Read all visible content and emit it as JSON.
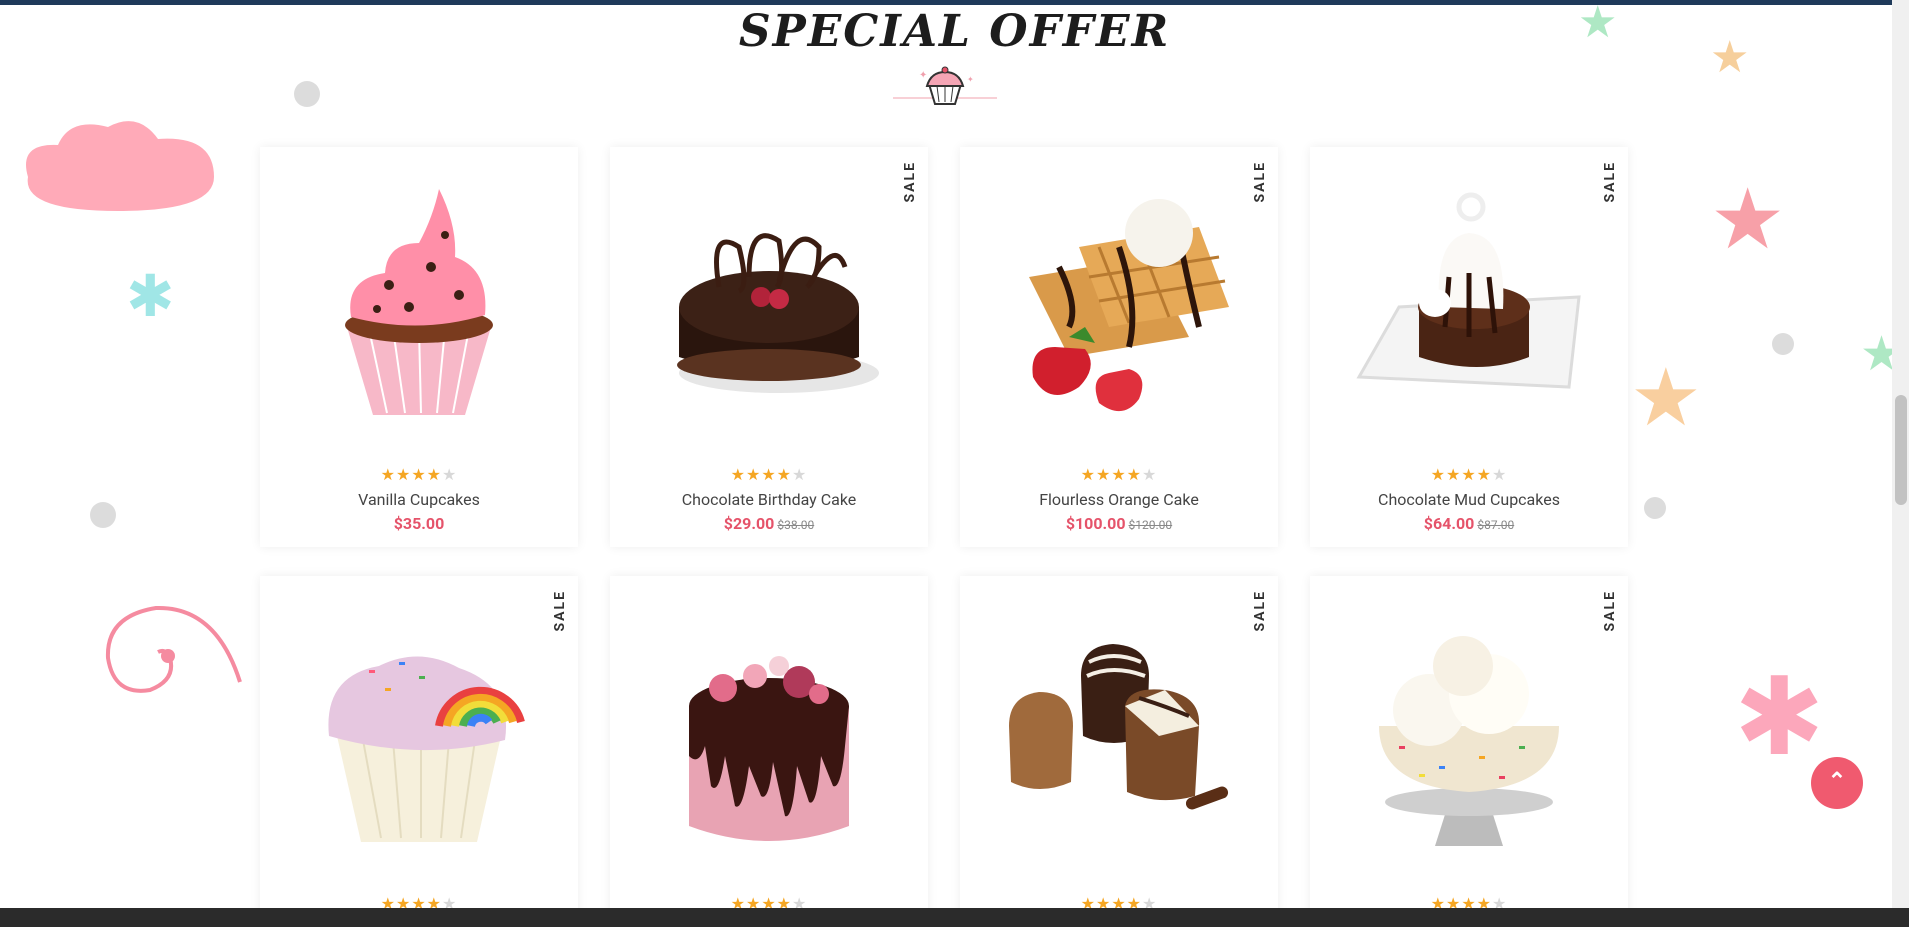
{
  "section": {
    "title": "SPECIAL OFFER"
  },
  "colors": {
    "accent": "#e5536a",
    "star": "#f5a623",
    "star_empty": "#d8d8d8",
    "back_to_top": "#f05a6f"
  },
  "products": [
    {
      "name": "Vanilla Cupcakes",
      "price": "$35.00",
      "old_price": "",
      "sale": "",
      "rating": 4,
      "image": "pink-frosted-cupcake"
    },
    {
      "name": "Chocolate Birthday Cake",
      "price": "$29.00",
      "old_price": "$38.00",
      "sale": "SALE",
      "rating": 4,
      "image": "chocolate-cake"
    },
    {
      "name": "Flourless Orange Cake",
      "price": "$100.00",
      "old_price": "$120.00",
      "sale": "SALE",
      "rating": 4,
      "image": "waffles-strawberries"
    },
    {
      "name": "Chocolate Mud Cupcakes",
      "price": "$64.00",
      "old_price": "$87.00",
      "sale": "SALE",
      "rating": 4,
      "image": "chocolate-mud-cake-plate"
    },
    {
      "name": "",
      "price": "",
      "old_price": "",
      "sale": "SALE",
      "rating": 4,
      "image": "rainbow-cupcake"
    },
    {
      "name": "",
      "price": "",
      "old_price": "",
      "sale": "",
      "rating": 4,
      "image": "pink-drip-cake"
    },
    {
      "name": "",
      "price": "",
      "old_price": "",
      "sale": "SALE",
      "rating": 4,
      "image": "chocolate-truffles"
    },
    {
      "name": "",
      "price": "",
      "old_price": "",
      "sale": "SALE",
      "rating": 4,
      "image": "ice-cream-sprinkle-bowl"
    }
  ],
  "back_to_top": {
    "icon": "double-chevron-up-icon",
    "glyph": "⌃"
  }
}
